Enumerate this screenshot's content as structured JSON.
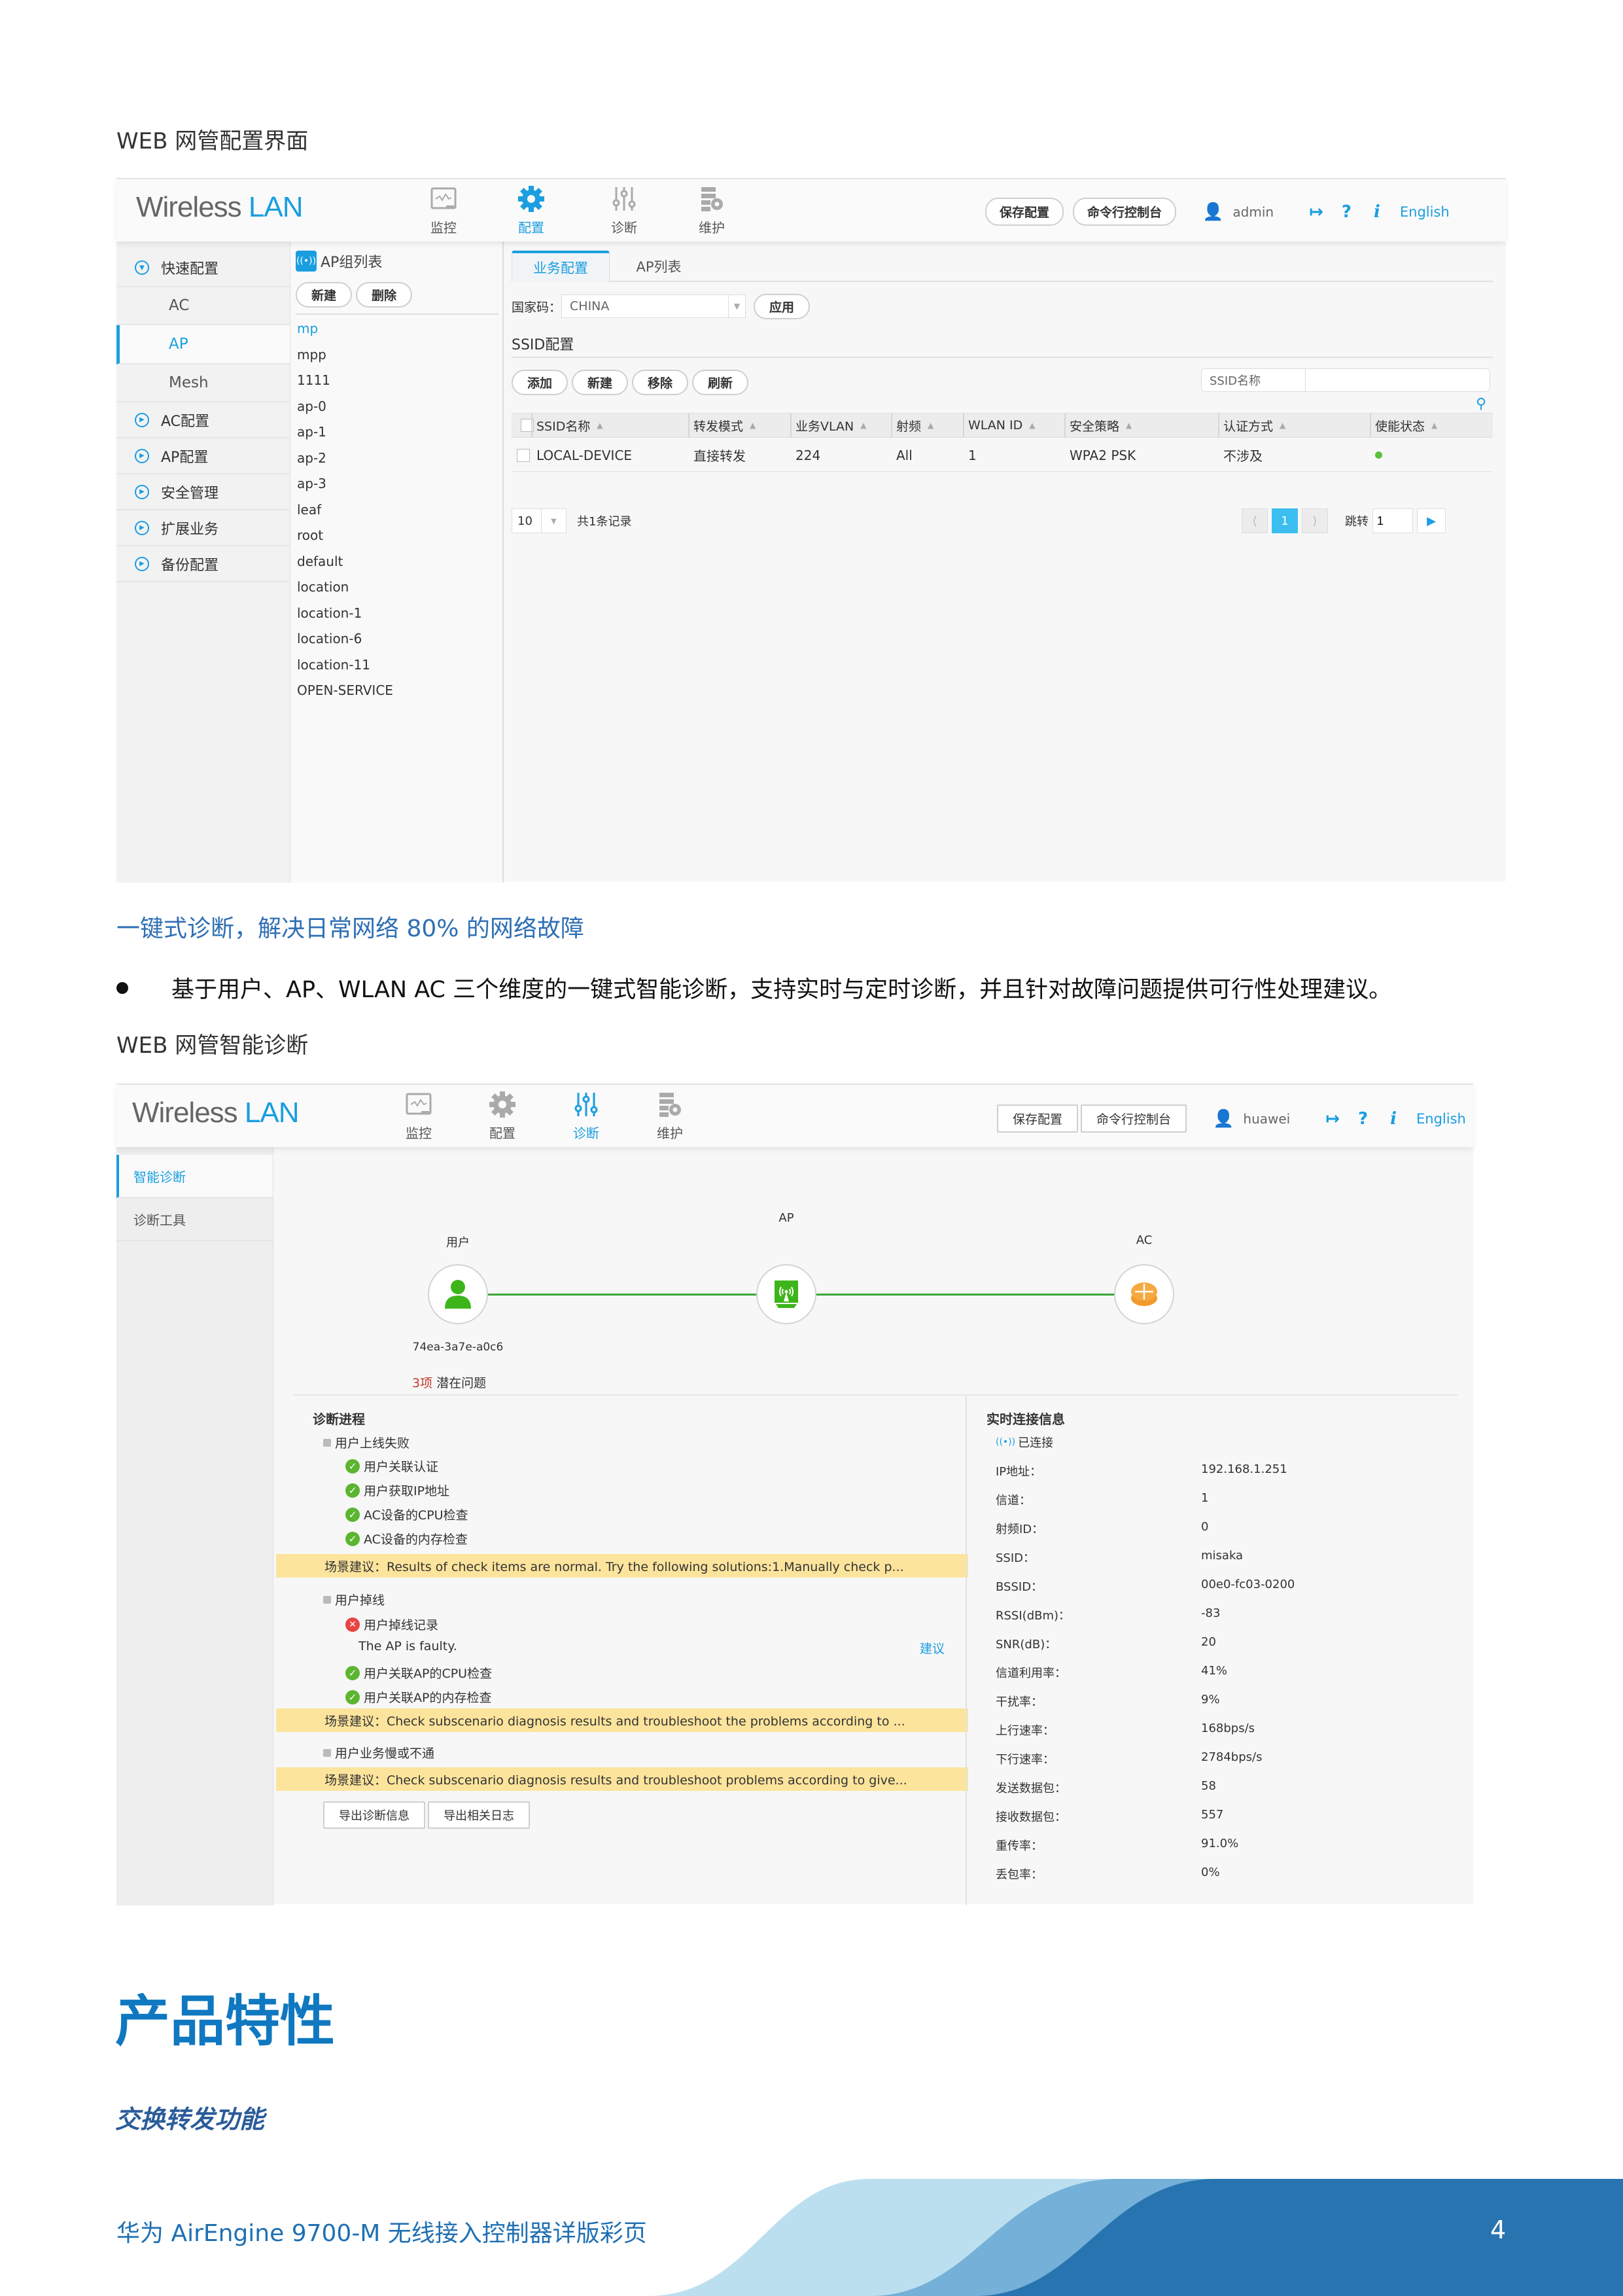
{
  "section1": {
    "caption": "WEB 网管配置界面"
  },
  "app1": {
    "logo_main": "Wireless",
    "logo_accent": "LAN",
    "nav": [
      {
        "label": "监控",
        "icon": "monitor-icon",
        "active": false
      },
      {
        "label": "配置",
        "icon": "gear-icon",
        "active": true
      },
      {
        "label": "诊断",
        "icon": "sliders-icon",
        "active": false
      },
      {
        "label": "维护",
        "icon": "maintenance-icon",
        "active": false
      }
    ],
    "header": {
      "save_label": "保存配置",
      "cli_label": "命令行控制台",
      "username": "admin",
      "language": "English"
    },
    "sidebar": [
      {
        "label": "快速配置",
        "expanded": true
      },
      {
        "label": "AC",
        "sub": true
      },
      {
        "label": "AP",
        "sub": true,
        "selected": true
      },
      {
        "label": "Mesh",
        "sub": true
      },
      {
        "label": "AC配置"
      },
      {
        "label": "AP配置"
      },
      {
        "label": "安全管理"
      },
      {
        "label": "扩展业务"
      },
      {
        "label": "备份配置"
      }
    ],
    "ap_group": {
      "title": "AP组列表",
      "new_label": "新建",
      "delete_label": "删除",
      "items": [
        "mp",
        "mpp",
        "1111",
        "ap-0",
        "ap-1",
        "ap-2",
        "ap-3",
        "leaf",
        "root",
        "default",
        "location",
        "location-1",
        "location-6",
        "location-11",
        "OPEN-SERVICE"
      ]
    },
    "tabs": [
      "业务配置",
      "AP列表"
    ],
    "country": {
      "label": "国家码：",
      "value": "CHINA",
      "apply_label": "应用"
    },
    "ssid_section": "SSID配置",
    "ssid_buttons": [
      "添加",
      "新建",
      "移除",
      "刷新"
    ],
    "ssid_search_label": "SSID名称",
    "ssid_search_value": "",
    "table": {
      "columns": [
        "SSID名称",
        "转发模式",
        "业务VLAN",
        "射频",
        "WLAN ID",
        "安全策略",
        "认证方式",
        "使能状态"
      ],
      "rows": [
        {
          "ssid": "LOCAL-DEVICE",
          "mode": "直接转发",
          "vlan": "224",
          "radio": "All",
          "wlan_id": "1",
          "security": "WPA2 PSK",
          "auth": "不涉及",
          "enabled": true
        }
      ]
    },
    "pager": {
      "page_size": "10",
      "total": "共1条记录",
      "current_page": "1",
      "jump_label": "跳转",
      "jump_value": "1"
    }
  },
  "section2": {
    "heading": "一键式诊断，解决日常网络 80% 的网络故障",
    "bullet": "基于用户、AP、WLAN AC 三个维度的一键式智能诊断，支持实时与定时诊断，并且针对故障问题提供可行性处理建议。",
    "caption": "WEB 网管智能诊断"
  },
  "app2": {
    "logo_main": "Wireless",
    "logo_accent": "LAN",
    "nav": [
      {
        "label": "监控",
        "icon": "monitor-icon",
        "active": false
      },
      {
        "label": "配置",
        "icon": "gear-icon",
        "active": false
      },
      {
        "label": "诊断",
        "icon": "sliders-icon",
        "active": true
      },
      {
        "label": "维护",
        "icon": "maintenance-icon",
        "active": false
      }
    ],
    "header": {
      "save_label": "保存配置",
      "cli_label": "命令行控制台",
      "username": "huawei",
      "language": "English"
    },
    "sidebar": [
      {
        "label": "智能诊断",
        "selected": true
      },
      {
        "label": "诊断工具"
      }
    ],
    "topology": {
      "user_label": "用户",
      "ap_label": "AP",
      "ac_label": "AC",
      "user_mac": "74ea-3a7e-a0c6",
      "issue_count": "3项",
      "issue_text": "潜在问题",
      "link_color": "#3aa63a"
    },
    "progress": {
      "title": "诊断进程",
      "groups": [
        {
          "label": "用户上线失败",
          "items": [
            {
              "label": "用户关联认证",
              "status": "ok"
            },
            {
              "label": "用户获取IP地址",
              "status": "ok"
            },
            {
              "label": "AC设备的CPU检查",
              "status": "ok"
            },
            {
              "label": "AC设备的内存检查",
              "status": "ok"
            }
          ],
          "advice": "场景建议：Results of check items are normal. Try the following solutions:1.Manually check p..."
        },
        {
          "label": "用户掉线",
          "items": [
            {
              "label": "用户掉线记录",
              "status": "error",
              "detail": "The AP is faulty.",
              "link": "建议"
            },
            {
              "label": "用户关联AP的CPU检查",
              "status": "ok"
            },
            {
              "label": "用户关联AP的内存检查",
              "status": "ok"
            }
          ],
          "advice": "场景建议：Check subscenario diagnosis results and troubleshoot the problems according to ..."
        },
        {
          "label": "用户业务慢或不通",
          "items": [],
          "advice": "场景建议：Check subscenario diagnosis results and troubleshoot problems according to give..."
        }
      ],
      "export_info_label": "导出诊断信息",
      "export_log_label": "导出相关日志"
    },
    "realtime": {
      "title": "实时连接信息",
      "status": "已连接",
      "fields": [
        {
          "k": "IP地址：",
          "v": "192.168.1.251"
        },
        {
          "k": "信道：",
          "v": "1"
        },
        {
          "k": "射频ID：",
          "v": "0"
        },
        {
          "k": "SSID：",
          "v": "misaka"
        },
        {
          "k": "BSSID：",
          "v": "00e0-fc03-0200"
        },
        {
          "k": "RSSI(dBm)：",
          "v": "-83"
        },
        {
          "k": "SNR(dB)：",
          "v": "20"
        },
        {
          "k": "信道利用率：",
          "v": "41%"
        },
        {
          "k": "干扰率：",
          "v": "9%"
        },
        {
          "k": "上行速率：",
          "v": "168bps/s"
        },
        {
          "k": "下行速率：",
          "v": "2784bps/s"
        },
        {
          "k": "发送数据包：",
          "v": "58"
        },
        {
          "k": "接收数据包：",
          "v": "557"
        },
        {
          "k": "重传率：",
          "v": "91.0%"
        },
        {
          "k": "丢包率：",
          "v": "0%"
        }
      ]
    }
  },
  "section3": {
    "title": "产品特性",
    "subtitle": "交换转发功能"
  },
  "footer": {
    "doc_title": "华为 AirEngine 9700-M 无线接入控制器详版彩页",
    "page_number": "4",
    "colors": {
      "light": "#bcdff0",
      "mid": "#74b0d8",
      "dark": "#2874b0"
    }
  },
  "colors": {
    "accent": "#1a9ee0",
    "heading_blue": "#0f78c0",
    "advice_yellow": "#fde49c",
    "ok_green": "#5cb531",
    "error_red": "#e84444"
  }
}
